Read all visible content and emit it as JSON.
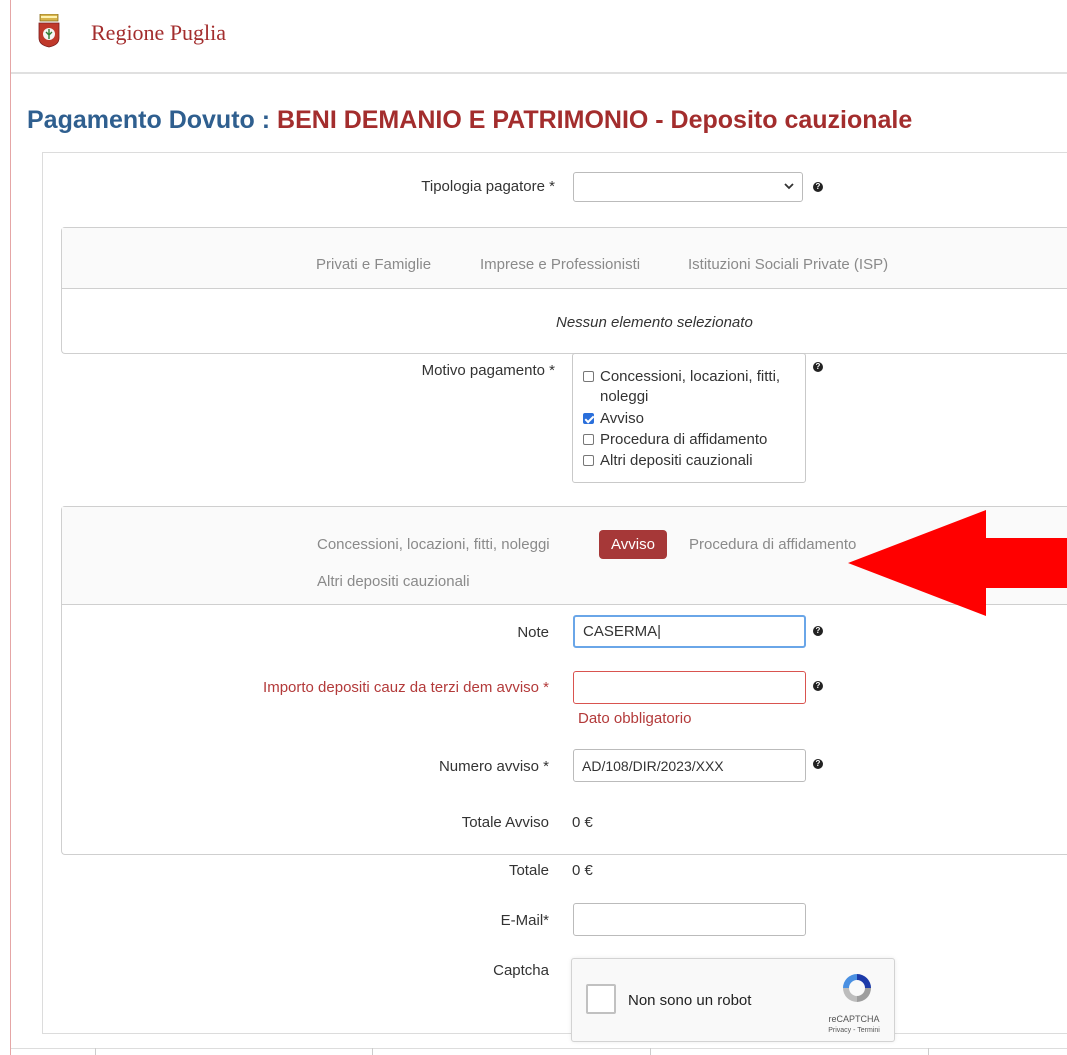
{
  "brand": {
    "name": "Regione Puglia"
  },
  "page": {
    "title_prefix": "Pagamento Dovuto :",
    "title_main": "BENI DEMANIO E PATRIMONIO - Deposito cauzionale"
  },
  "form": {
    "tipologia_label": "Tipologia pagatore *",
    "tipologia_value": "",
    "tipologia_tabs": [
      "Privati e Famiglie",
      "Imprese e Professionisti",
      "Istituzioni Sociali Private (ISP)"
    ],
    "tipologia_empty": "Nessun elemento selezionato",
    "motivo_label": "Motivo pagamento *",
    "motivo_options": [
      {
        "label": "Concessioni, locazioni, fitti, noleggi",
        "checked": false
      },
      {
        "label": "Avviso",
        "checked": true
      },
      {
        "label": "Procedura di affidamento",
        "checked": false
      },
      {
        "label": "Altri depositi cauzionali",
        "checked": false
      }
    ],
    "motivo_tabs": [
      "Concessioni, locazioni, fitti, noleggi",
      "Avviso",
      "Procedura di affidamento",
      "Altri depositi cauzionali"
    ],
    "motivo_active": "Avviso",
    "note_label": "Note",
    "note_value": "CASERMA|",
    "importo_label": "Importo depositi cauz da terzi dem avviso *",
    "importo_value": "",
    "importo_error": "Dato obbligatorio",
    "numero_label": "Numero avviso *",
    "numero_value": "AD/108/DIR/2023/XXX",
    "totale_avviso_label": "Totale Avviso",
    "totale_avviso_value": "0 €",
    "totale_label": "Totale",
    "totale_value": "0 €",
    "email_label": "E-Mail*",
    "email_value": "",
    "captcha_label": "Captcha"
  },
  "captcha": {
    "checkbox_label": "Non sono un robot",
    "brand": "reCAPTCHA",
    "links": "Privacy - Termini"
  },
  "icons": {
    "help": "help-icon",
    "chevron": "chevron-down-icon",
    "logo": "coat-of-arms-icon",
    "arrow": "red-arrow-annotation",
    "recaptcha": "recaptcha-icon"
  },
  "colors": {
    "brand_red": "#a32d2d",
    "title_blue": "#2f5f8f",
    "active_tab": "#a63838",
    "error": "#b33a3a",
    "annotation": "#ff0000"
  }
}
